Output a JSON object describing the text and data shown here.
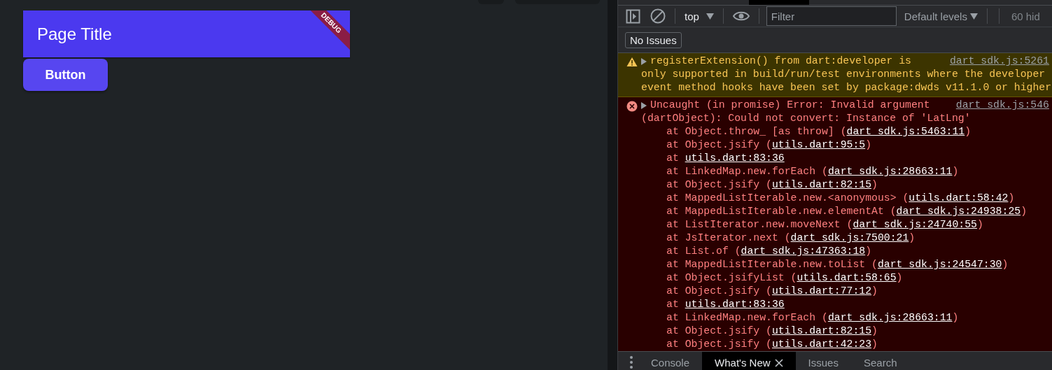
{
  "app": {
    "title": "Page Title",
    "ribbon": "DEBUG",
    "button": "Button"
  },
  "toolbar": {
    "context": "top",
    "filter_placeholder": "Filter",
    "levels": "Default levels",
    "hidden_count": "60 hid"
  },
  "issues_button": "No Issues",
  "messages": [
    {
      "kind": "warning",
      "lines": [
        "registerExtension() from dart:developer is",
        "only supported in build/run/test environments where the developer",
        "event method hooks have been set by package:dwds v11.1.0 or higher"
      ],
      "source": "dart_sdk.js:5261"
    },
    {
      "kind": "error",
      "lines": [
        "Uncaught (in promise) Error: Invalid argument",
        "(dartObject): Could not convert: Instance of 'LatLng'"
      ],
      "source": "dart_sdk.js:546",
      "frames": [
        {
          "text": "at Object.throw_ [as throw] (",
          "link": "dart_sdk.js:5463:11",
          "end": ")"
        },
        {
          "text": "at Object.jsify (",
          "link": "utils.dart:95:5",
          "end": ")"
        },
        {
          "text": "at ",
          "link": "utils.dart:83:36"
        },
        {
          "text": "at LinkedMap.new.forEach (",
          "link": "dart_sdk.js:28663:11",
          "end": ")"
        },
        {
          "text": "at Object.jsify (",
          "link": "utils.dart:82:15",
          "end": ")"
        },
        {
          "text": "at MappedListIterable.new.<anonymous> (",
          "link": "utils.dart:58:42",
          "end": ")"
        },
        {
          "text": "at MappedListIterable.new.elementAt (",
          "link": "dart_sdk.js:24938:25",
          "end": ")"
        },
        {
          "text": "at ListIterator.new.moveNext (",
          "link": "dart_sdk.js:24740:55",
          "end": ")"
        },
        {
          "text": "at JsIterator.next (",
          "link": "dart_sdk.js:7500:21",
          "end": ")"
        },
        {
          "text": "at List.of (",
          "link": "dart_sdk.js:47363:18",
          "end": ")"
        },
        {
          "text": "at MappedListIterable.new.toList (",
          "link": "dart_sdk.js:24547:30",
          "end": ")"
        },
        {
          "text": "at Object.jsifyList (",
          "link": "utils.dart:58:65",
          "end": ")"
        },
        {
          "text": "at Object.jsify (",
          "link": "utils.dart:77:12",
          "end": ")"
        },
        {
          "text": "at ",
          "link": "utils.dart:83:36"
        },
        {
          "text": "at LinkedMap.new.forEach (",
          "link": "dart_sdk.js:28663:11",
          "end": ")"
        },
        {
          "text": "at Object.jsify (",
          "link": "utils.dart:82:15",
          "end": ")"
        },
        {
          "text": "at Object.jsify (",
          "link": "utils.dart:42:23",
          "end": ")"
        }
      ]
    }
  ],
  "drawer_tabs": [
    {
      "label": "Console",
      "selected": false,
      "closable": false
    },
    {
      "label": "What's New",
      "selected": true,
      "closable": true
    },
    {
      "label": "Issues",
      "selected": false,
      "closable": false
    },
    {
      "label": "Search",
      "selected": false,
      "closable": false
    }
  ]
}
